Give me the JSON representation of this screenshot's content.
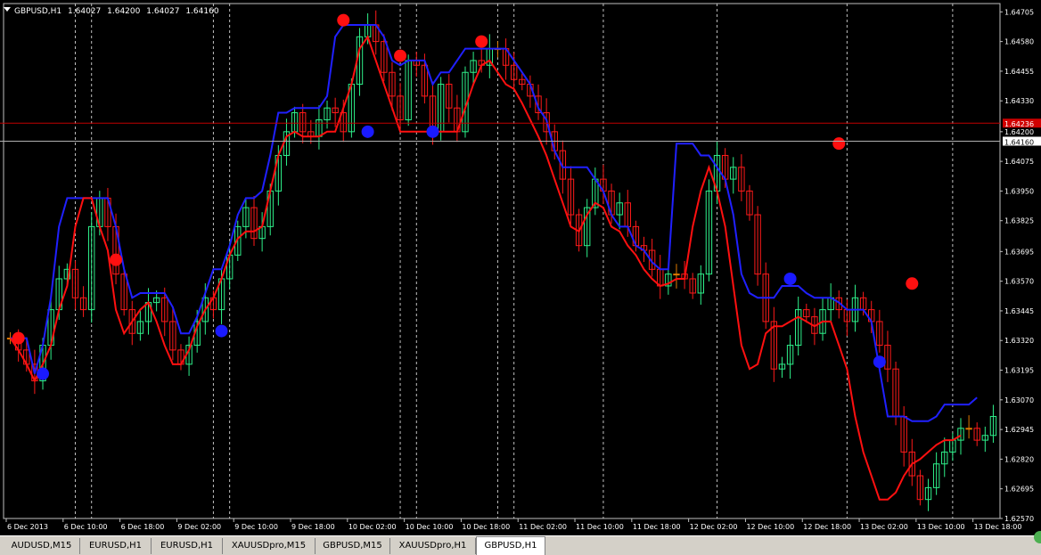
{
  "window": {
    "title": "GBPUSD,H1",
    "ohlc_values": [
      "1.64027",
      "1.64200",
      "1.64027",
      "1.64160"
    ]
  },
  "colors": {
    "background": "#000000",
    "grid": "#c0c0c0",
    "bull_candle": "#2ef08a",
    "bear_candle": "#ff1a1a",
    "doji_candle": "#e07a00",
    "upper_band": "#2020ff",
    "lower_band": "#ff1010",
    "top_dot": "#ff1010",
    "bottom_dot": "#1a1aff",
    "bid_line": "#c00000",
    "ask_line": "#b0b0b0"
  },
  "chart_data": {
    "type": "line",
    "symbol": "GBPUSD",
    "timeframe": "H1",
    "ylim": [
      1.6257,
      1.6474
    ],
    "y_ticks": [
      "1.64705",
      "1.64580",
      "1.64455",
      "1.64330",
      "1.64200",
      "1.64075",
      "1.63950",
      "1.63825",
      "1.63695",
      "1.63570",
      "1.63445",
      "1.63320",
      "1.63195",
      "1.63070",
      "1.62945",
      "1.62820",
      "1.62695",
      "1.62570"
    ],
    "x_labels": [
      "6 Dec 2013",
      "6 Dec 10:00",
      "6 Dec 18:00",
      "9 Dec 02:00",
      "9 Dec 10:00",
      "9 Dec 18:00",
      "10 Dec 02:00",
      "10 Dec 10:00",
      "10 Dec 18:00",
      "11 Dec 02:00",
      "11 Dec 10:00",
      "11 Dec 18:00",
      "12 Dec 02:00",
      "12 Dec 10:00",
      "12 Dec 18:00",
      "13 Dec 02:00",
      "13 Dec 10:00",
      "13 Dec 18:00"
    ],
    "bid_price": "1.64236",
    "ask_price": "1.64160",
    "series": [
      {
        "name": "close",
        "values": [
          1.6333,
          1.6328,
          1.6322,
          1.6315,
          1.633,
          1.6345,
          1.6358,
          1.6362,
          1.635,
          1.6345,
          1.638,
          1.6392,
          1.638,
          1.636,
          1.6345,
          1.6335,
          1.634,
          1.6348,
          1.635,
          1.634,
          1.6328,
          1.6322,
          1.633,
          1.634,
          1.635,
          1.6345,
          1.6358,
          1.6368,
          1.638,
          1.6388,
          1.6375,
          1.638,
          1.6395,
          1.641,
          1.642,
          1.6428,
          1.642,
          1.6418,
          1.6425,
          1.643,
          1.6428,
          1.642,
          1.644,
          1.646,
          1.6465,
          1.6458,
          1.6445,
          1.6435,
          1.6425,
          1.645,
          1.6448,
          1.6435,
          1.642,
          1.644,
          1.643,
          1.642,
          1.6445,
          1.645,
          1.6448,
          1.6455,
          1.6455,
          1.6448,
          1.6442,
          1.644,
          1.6435,
          1.6428,
          1.642,
          1.6412,
          1.64,
          1.6385,
          1.6372,
          1.6388,
          1.64,
          1.6395,
          1.6385,
          1.639,
          1.638,
          1.6372,
          1.637,
          1.6362,
          1.6355,
          1.636,
          1.636,
          1.6358,
          1.6352,
          1.636,
          1.6395,
          1.641,
          1.64,
          1.6405,
          1.6395,
          1.6385,
          1.636,
          1.634,
          1.632,
          1.6322,
          1.633,
          1.6345,
          1.6342,
          1.6335,
          1.6345,
          1.635,
          1.6345,
          1.634,
          1.635,
          1.6345,
          1.634,
          1.633,
          1.632,
          1.63,
          1.6285,
          1.6275,
          1.6265,
          1.627,
          1.628,
          1.6285,
          1.629,
          1.6295,
          1.6295,
          1.629,
          1.6292,
          1.63
        ]
      },
      {
        "name": "upper_band",
        "values": [
          1.6333,
          1.6333,
          1.6333,
          1.6318,
          1.633,
          1.635,
          1.638,
          1.6392,
          1.6392,
          1.6392,
          1.6392,
          1.6392,
          1.6392,
          1.638,
          1.6362,
          1.635,
          1.6352,
          1.6352,
          1.6352,
          1.6352,
          1.6346,
          1.6335,
          1.6335,
          1.6342,
          1.6352,
          1.6362,
          1.6362,
          1.6372,
          1.6385,
          1.6392,
          1.6392,
          1.6395,
          1.641,
          1.6428,
          1.6428,
          1.643,
          1.643,
          1.643,
          1.643,
          1.6435,
          1.646,
          1.6465,
          1.6465,
          1.6465,
          1.6465,
          1.6465,
          1.646,
          1.645,
          1.6448,
          1.645,
          1.645,
          1.645,
          1.644,
          1.6445,
          1.6445,
          1.645,
          1.6455,
          1.6455,
          1.6455,
          1.6455,
          1.6455,
          1.6455,
          1.645,
          1.6445,
          1.644,
          1.643,
          1.6425,
          1.6412,
          1.6405,
          1.6405,
          1.6405,
          1.6405,
          1.64,
          1.6395,
          1.6385,
          1.638,
          1.638,
          1.6372,
          1.637,
          1.6365,
          1.6362,
          1.6362,
          1.6415,
          1.6415,
          1.6415,
          1.641,
          1.641,
          1.6405,
          1.64,
          1.6385,
          1.636,
          1.6352,
          1.635,
          1.635,
          1.635,
          1.6355,
          1.6355,
          1.6355,
          1.6352,
          1.635,
          1.635,
          1.635,
          1.6348,
          1.6345,
          1.6345,
          1.6345,
          1.634,
          1.632,
          1.63,
          1.63,
          1.63,
          1.6298,
          1.6298,
          1.6298,
          1.63,
          1.6305,
          1.6305,
          1.6305,
          1.6305,
          1.6308
        ]
      },
      {
        "name": "lower_band",
        "values": [
          1.6333,
          1.6328,
          1.6322,
          1.6315,
          1.6322,
          1.633,
          1.6345,
          1.6355,
          1.638,
          1.6392,
          1.6392,
          1.638,
          1.637,
          1.6345,
          1.6335,
          1.634,
          1.6345,
          1.6348,
          1.634,
          1.633,
          1.6322,
          1.6322,
          1.6328,
          1.6338,
          1.6345,
          1.635,
          1.6358,
          1.6368,
          1.6375,
          1.6378,
          1.6378,
          1.638,
          1.6395,
          1.641,
          1.6418,
          1.642,
          1.6418,
          1.6418,
          1.6418,
          1.642,
          1.642,
          1.643,
          1.644,
          1.6455,
          1.646,
          1.645,
          1.644,
          1.643,
          1.642,
          1.642,
          1.642,
          1.642,
          1.642,
          1.642,
          1.642,
          1.642,
          1.643,
          1.644,
          1.6448,
          1.645,
          1.6445,
          1.644,
          1.6438,
          1.6432,
          1.6425,
          1.6418,
          1.641,
          1.64,
          1.639,
          1.638,
          1.6378,
          1.6385,
          1.639,
          1.6388,
          1.638,
          1.6378,
          1.6372,
          1.6368,
          1.6362,
          1.6358,
          1.6355,
          1.6356,
          1.6358,
          1.6358,
          1.638,
          1.6395,
          1.6405,
          1.6395,
          1.638,
          1.6355,
          1.633,
          1.632,
          1.6322,
          1.6335,
          1.6338,
          1.6338,
          1.634,
          1.6342,
          1.634,
          1.6338,
          1.634,
          1.634,
          1.633,
          1.632,
          1.63,
          1.6285,
          1.6275,
          1.6265,
          1.6265,
          1.6268,
          1.6275,
          1.628,
          1.6282,
          1.6285,
          1.6288,
          1.629,
          1.629,
          1.6292
        ]
      }
    ],
    "top_dots": [
      {
        "i": 1,
        "v": 1.6333
      },
      {
        "i": 13,
        "v": 1.6366
      },
      {
        "i": 41,
        "v": 1.6467
      },
      {
        "i": 48,
        "v": 1.6452
      },
      {
        "i": 58,
        "v": 1.6458
      },
      {
        "i": 102,
        "v": 1.6415
      },
      {
        "i": 111,
        "v": 1.6356
      }
    ],
    "bottom_dots": [
      {
        "i": 4,
        "v": 1.6318
      },
      {
        "i": 26,
        "v": 1.6336
      },
      {
        "i": 44,
        "v": 1.642
      },
      {
        "i": 52,
        "v": 1.642
      },
      {
        "i": 96,
        "v": 1.6358
      },
      {
        "i": 107,
        "v": 1.6323
      }
    ]
  },
  "tabs": [
    {
      "label": "AUDUSD,M15",
      "active": false
    },
    {
      "label": "EURUSD,H1",
      "active": false
    },
    {
      "label": "EURUSD,H1",
      "active": false
    },
    {
      "label": "XAUUSDpro,M15",
      "active": false
    },
    {
      "label": "GBPUSD,M15",
      "active": false
    },
    {
      "label": "XAUUSDpro,H1",
      "active": false
    },
    {
      "label": "GBPUSD,H1",
      "active": true
    }
  ]
}
